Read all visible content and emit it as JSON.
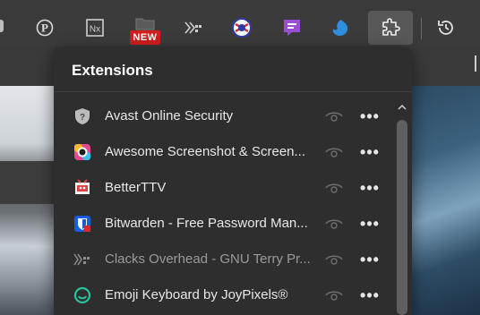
{
  "toolbar": {
    "icons": [
      {
        "name": "pinterest-icon"
      },
      {
        "name": "nx-icon",
        "text": "Nx"
      },
      {
        "name": "folder-icon"
      },
      {
        "name": "clacks-icon"
      },
      {
        "name": "vpn-icon"
      },
      {
        "name": "chat-icon"
      },
      {
        "name": "flame-icon"
      },
      {
        "name": "puzzle-extensions-icon"
      },
      {
        "name": "history-icon"
      }
    ],
    "new_badge": "NEW"
  },
  "panel": {
    "title": "Extensions",
    "items": [
      {
        "name": "Avast Online Security",
        "icon": "avast-shield-icon",
        "dimmed": false
      },
      {
        "name": "Awesome Screenshot & Screen...",
        "icon": "awesome-screenshot-icon",
        "dimmed": false
      },
      {
        "name": "BetterTTV",
        "icon": "betterttv-icon",
        "dimmed": false
      },
      {
        "name": "Bitwarden - Free Password Man...",
        "icon": "bitwarden-icon",
        "dimmed": false
      },
      {
        "name": "Clacks Overhead - GNU Terry Pr...",
        "icon": "clacks-overhead-icon",
        "dimmed": true
      },
      {
        "name": "Emoji Keyboard by JoyPixels®",
        "icon": "joypixels-icon",
        "dimmed": false
      }
    ],
    "more_label": "•••"
  },
  "colors": {
    "panel_bg": "#2e2e2e",
    "toolbar_bg": "#3b3b3b",
    "badge_red": "#d11d1d",
    "active_icon_bg": "#585858"
  }
}
